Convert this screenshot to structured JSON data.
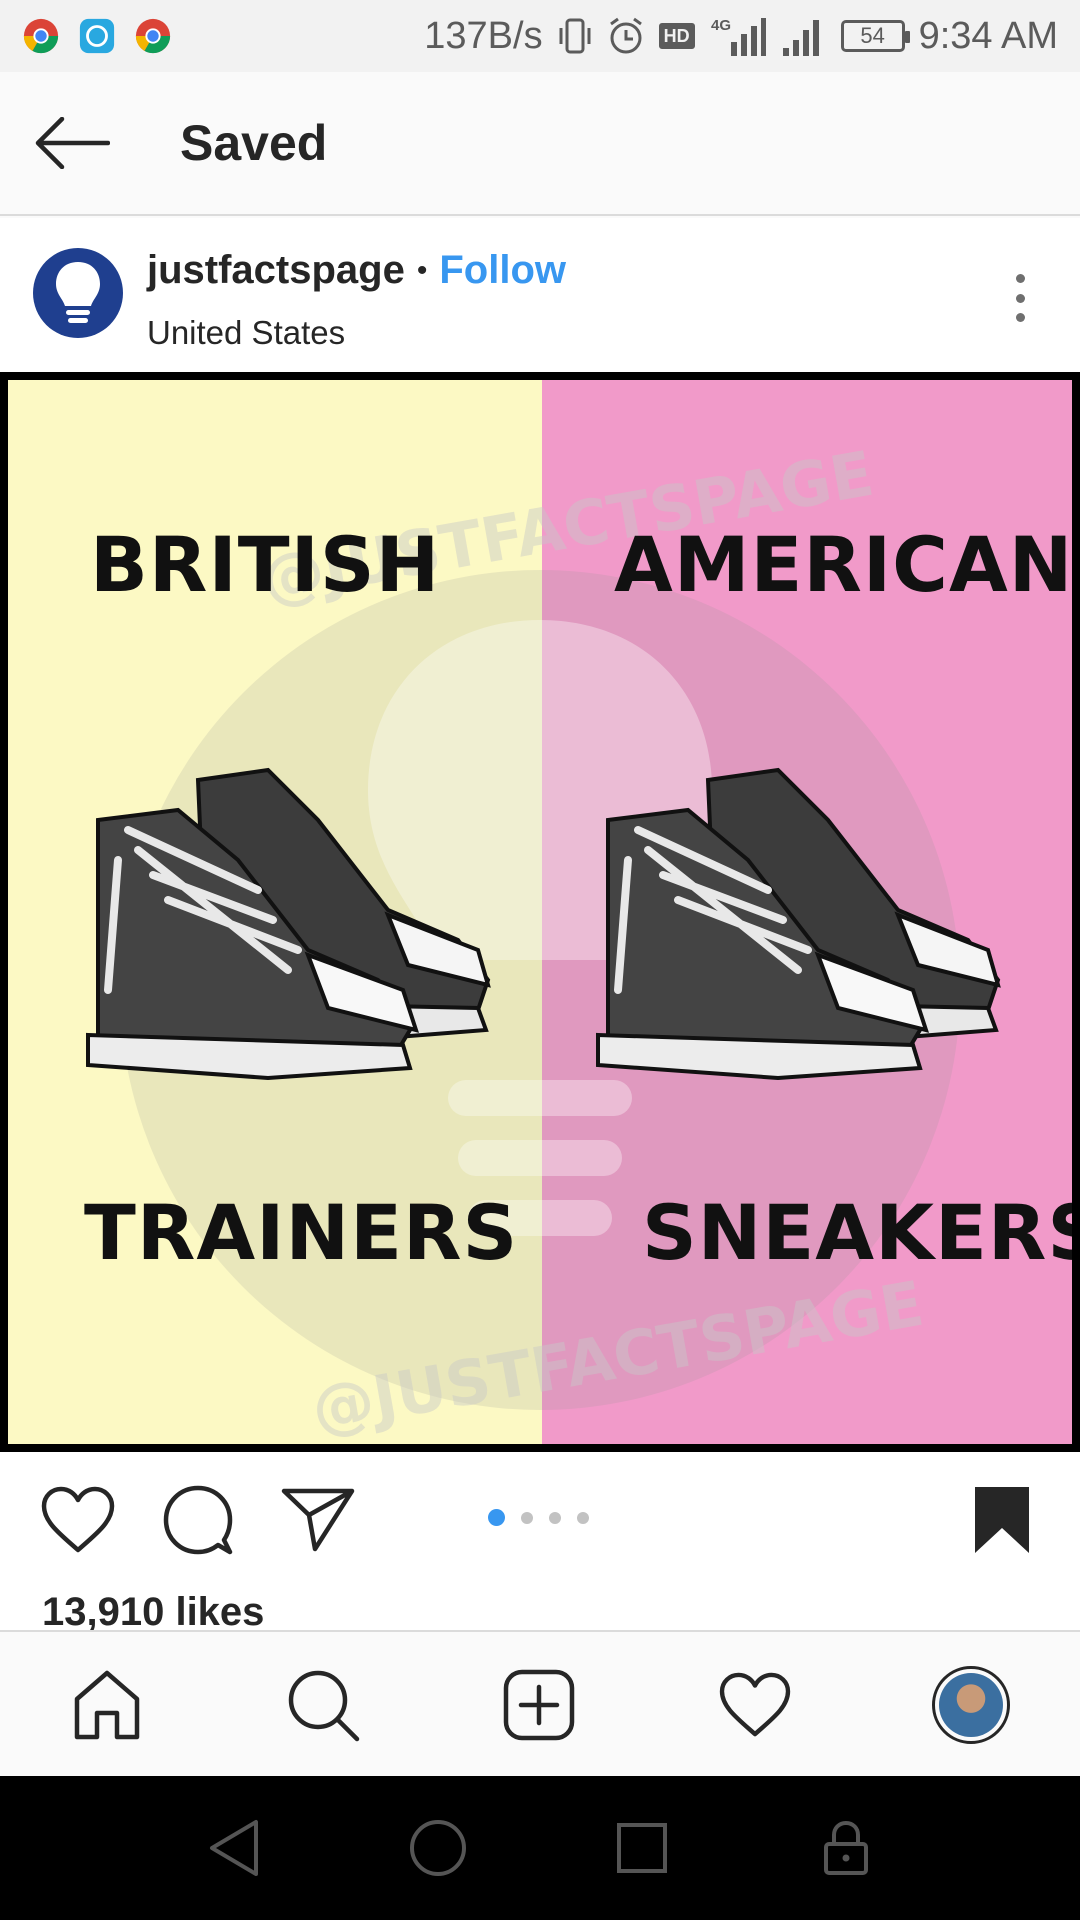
{
  "status_bar": {
    "speed": "137B/s",
    "hd": "HD",
    "network": "4G",
    "battery": "54",
    "time": "9:34 AM"
  },
  "header": {
    "title": "Saved",
    "back_icon": "arrow-left-icon"
  },
  "post": {
    "username": "justfactspage",
    "separator": "•",
    "follow_label": "Follow",
    "location": "United States",
    "image": {
      "left_top": "BRITISH",
      "right_top": "AMERICAN",
      "left_bottom": "TRAINERS",
      "right_bottom": "SNEAKERS",
      "watermark": "@JUSTFACTSPAGE",
      "left_color": "#fcf9c4",
      "right_color": "#f19ac9"
    },
    "carousel": {
      "count": 4,
      "active": 1
    },
    "likes": "13,910 likes"
  },
  "colors": {
    "accent": "#3897f0",
    "text": "#262626",
    "avatar": "#1f3f8f"
  },
  "bottom_nav": [
    "home-icon",
    "search-icon",
    "new-post-icon",
    "activity-heart-icon",
    "profile-avatar"
  ],
  "system_nav": [
    "back-triangle-icon",
    "home-circle-icon",
    "recents-square-icon",
    "lock-icon"
  ]
}
